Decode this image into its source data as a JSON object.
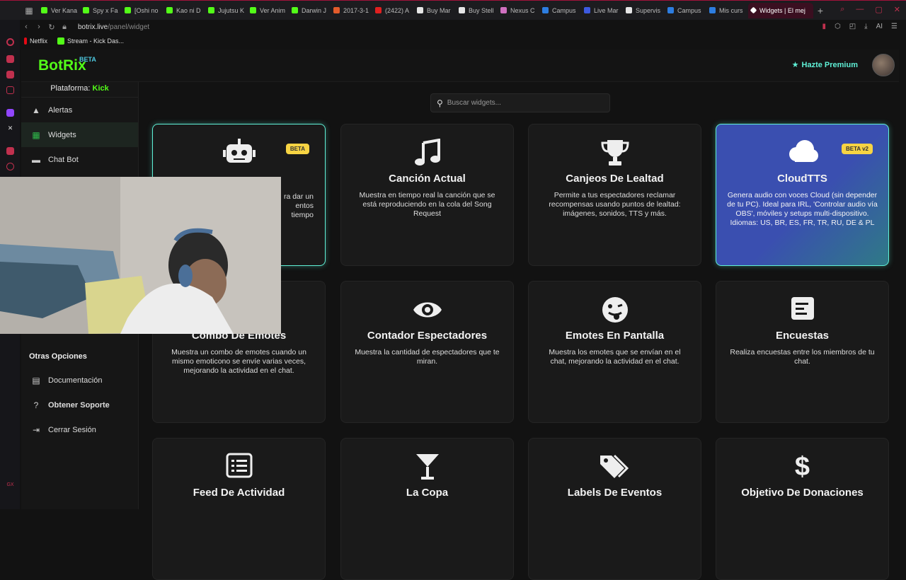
{
  "browser": {
    "tabs": [
      {
        "label": "Ver Kana",
        "color": "#53fc18"
      },
      {
        "label": "Spy x Fa",
        "color": "#53fc18"
      },
      {
        "label": "[Oshi no",
        "color": "#53fc18"
      },
      {
        "label": "Kao ni D",
        "color": "#53fc18"
      },
      {
        "label": "Jujutsu K",
        "color": "#53fc18"
      },
      {
        "label": "Ver Anim",
        "color": "#53fc18"
      },
      {
        "label": "Darwin J",
        "color": "#53fc18"
      },
      {
        "label": "2017-3-1",
        "color": "#e25b2b"
      },
      {
        "label": "(2422) A",
        "color": "#e02020"
      },
      {
        "label": "Buy Mar",
        "color": "#e6e6e6"
      },
      {
        "label": "Buy Stell",
        "color": "#e6e6e6"
      },
      {
        "label": "Nexus C",
        "color": "#d070c0"
      },
      {
        "label": "Campus",
        "color": "#2d7de0"
      },
      {
        "label": "Live Mar",
        "color": "#3d5ae0"
      },
      {
        "label": "Supervis",
        "color": "#e6e6e6"
      },
      {
        "label": "Campus",
        "color": "#2d7de0"
      },
      {
        "label": "Mis curs",
        "color": "#2d7de0"
      }
    ],
    "active_tab": {
      "label": "Widgets | El mej",
      "color": "#ffffff"
    },
    "new_tab": "+",
    "url_host": "botrix.live",
    "url_path": "/panel/widget",
    "ai_label": "AI",
    "bookmarks": [
      {
        "label": "Netflix",
        "color": "#e50914"
      },
      {
        "label": "Stream - Kick Das...",
        "color": "#53fc18"
      }
    ]
  },
  "app": {
    "logo": "BotRix",
    "logo_badge": "BETA",
    "premium_label": "Hazte Premium",
    "platform_label": "Plataforma:",
    "platform_value": "Kick",
    "sidebar_items": [
      {
        "label": "Alertas",
        "icon": "warning-icon"
      },
      {
        "label": "Widgets",
        "icon": "grid-icon"
      },
      {
        "label": "Chat Bot",
        "icon": "chat-icon"
      }
    ],
    "other_section": "Otras Opciones",
    "other_items": [
      {
        "label": "Documentación",
        "icon": "scroll-icon"
      },
      {
        "label": "Obtener Soporte",
        "icon": "question-icon"
      },
      {
        "label": "Cerrar Sesión",
        "icon": "logout-icon"
      }
    ],
    "search_placeholder": "Buscar widgets..."
  },
  "cards": [
    {
      "title": "",
      "icon": "robot-icon",
      "badge": "BETA",
      "desc": "",
      "desc_partial": [
        "ra dar un",
        "entos",
        "tiempo"
      ]
    },
    {
      "title": "Canción Actual",
      "icon": "music-icon",
      "desc": "Muestra en tiempo real la canción que se está reproduciendo en la cola del Song Request"
    },
    {
      "title": "Canjeos De Lealtad",
      "icon": "trophy-icon",
      "desc": "Permite a tus espectadores reclamar recompensas usando puntos de lealtad: imágenes, sonidos, TTS y más."
    },
    {
      "title": "CloudTTS",
      "icon": "cloud-icon",
      "badge": "BETA v2",
      "desc": "Genera audio con voces Cloud (sin depender de tu PC). Ideal para IRL, 'Controlar audio vía OBS', móviles y setups multi-dispositivo. Idiomas: US, BR, ES, FR, TR, RU, DE & PL"
    },
    {
      "title": "Combo De Emotes",
      "icon": "",
      "desc": "Muestra un combo de emotes cuando un mismo emoticono se envíe varias veces, mejorando la actividad en el chat."
    },
    {
      "title": "Contador Espectadores",
      "icon": "eye-icon",
      "desc": "Muestra la cantidad de espectadores que te miran."
    },
    {
      "title": "Emotes En Pantalla",
      "icon": "emote-icon",
      "desc": "Muestra los emotes que se envían en el chat, mejorando la actividad en el chat."
    },
    {
      "title": "Encuestas",
      "icon": "poll-icon",
      "desc": "Realiza encuestas entre los miembros de tu chat."
    },
    {
      "title": "Feed De Actividad",
      "icon": "list-icon",
      "desc": ""
    },
    {
      "title": "La Copa",
      "icon": "cocktail-icon",
      "desc": ""
    },
    {
      "title": "Labels De Eventos",
      "icon": "tags-icon",
      "desc": ""
    },
    {
      "title": "Objetivo De Donaciones",
      "icon": "dollar-icon",
      "desc": ""
    }
  ],
  "colors": {
    "kick_green": "#53fc18",
    "teal": "#5ff0d6",
    "badge_yellow": "#f7d443",
    "cloud_card": "#3a4fb0"
  }
}
